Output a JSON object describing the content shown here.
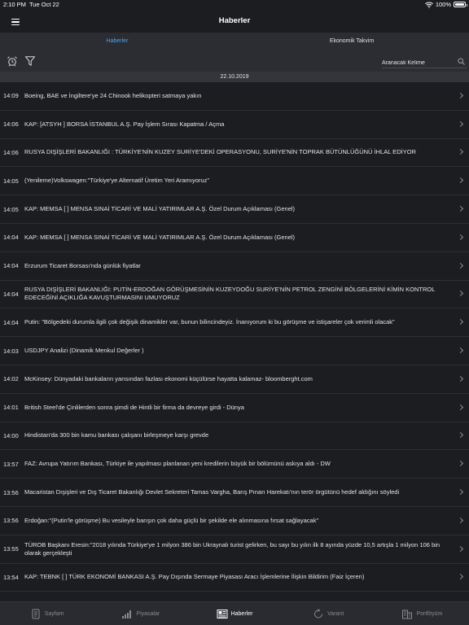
{
  "status_bar": {
    "time": "2:10 PM",
    "date": "Tue Oct 22",
    "battery": "100%"
  },
  "nav": {
    "title": "Haberler"
  },
  "tabs": [
    {
      "label": "Haberler",
      "active": true
    },
    {
      "label": "Ekonomik Takvim",
      "active": false
    }
  ],
  "toolbar": {
    "search_placeholder": "Aranacak Kelime"
  },
  "date_header": "22.10.2019",
  "news": [
    {
      "time": "14:09",
      "headline": "Boeing, BAE ve İngiltere'ye 24 Chinook helikopteri satmaya yakın"
    },
    {
      "time": "14:06",
      "headline": "KAP:   [ATSYH ] BORSA İSTANBUL A.Ş.  Pay İşlem Sırası Kapatma / Açma"
    },
    {
      "time": "14:06",
      "headline": "RUSYA DIŞİŞLERİ BAKANLIĞI : TÜRKİYE'NİN KUZEY SURİYE'DEKİ OPERASYONU, SURİYE'NİN TOPRAK BÜTÜNLÜĞÜNÜ İHLAL EDİYOR"
    },
    {
      "time": "14:05",
      "headline": "(Yenileme)Volkswagen:\"Türkiye'ye Alternatif Üretim Yeri Aramıyoruz\""
    },
    {
      "time": "14:05",
      "headline": "KAP: MEMSA  [ ] MENSA SINAİ TİCARİ VE MALİ YATIRIMLAR A.Ş.  Özel Durum Açıklaması (Genel)"
    },
    {
      "time": "14:04",
      "headline": "KAP: MEMSA  [ ] MENSA SINAİ TİCARİ VE MALİ YATIRIMLAR A.Ş.  Özel Durum Açıklaması (Genel)"
    },
    {
      "time": "14:04",
      "headline": "Erzurum Ticaret Borsası'nda günlük fiyatlar"
    },
    {
      "time": "14:04",
      "headline": "RUSYA DIŞİŞLERİ BAKANLIĞI: PUTİN-ERDOĞAN GÖRÜŞMESİNİN KUZEYDOĞU SURİYE'NİN PETROL ZENGİNİ BÖLGELERİNİ KİMİN KONTROL EDECEĞİNİ AÇIKLIĞA KAVUŞTURMASINI UMUYORUZ"
    },
    {
      "time": "14:04",
      "headline": "Putin: \"Bölgedeki durumla ilgili çok değişik dinamikler var, bunun bilincindeyiz. İnanıyorum ki bu görüşme ve istişareler çok verimli olacak\""
    },
    {
      "time": "14:03",
      "headline": "USDJPY Analizi (Dinamik Menkul Değerler )"
    },
    {
      "time": "14:02",
      "headline": "McKinsey: Dünyadaki bankaların yarısından fazlası ekonomi küçülürse hayatta kalamaz-  bloomberght.com"
    },
    {
      "time": "14:01",
      "headline": "British Steel'de Çinlilerden sonra şimdi de Hintli bir firma da devreye girdi - Dünya"
    },
    {
      "time": "14:00",
      "headline": "Hindistan'da 300 bin kamu bankası çalışanı birleşmeye karşı grevde"
    },
    {
      "time": "13:57",
      "headline": "FAZ: Avrupa Yatırım Bankası, Türkiye ile yapılması planlanan yeni kredilerin büyük bir bölümünü askıya aldı - DW"
    },
    {
      "time": "13:56",
      "headline": "Macaristan Dışişleri ve Dış Ticaret Bakanlığı Devlet Sekreteri Tamas Vargha, Barış Pınarı Harekatı'nın terör örgütünü hedef aldığını söyledi"
    },
    {
      "time": "13:56",
      "headline": "Erdoğan:\"(Putin'le görüşme) Bu vesileyle barışın çok daha güçlü bir şekilde ele alınmasına fırsat sağlayacak\""
    },
    {
      "time": "13:55",
      "headline": "TÜROB Başkanı Eresin:\"2018 yılında Türkiye'ye 1 milyon 386 bin Ukraynalı turist gelirken, bu sayı bu yılın ilk 8 ayında yüzde 10,5 artışla 1 milyon 106 bin olarak gerçekleşti"
    },
    {
      "time": "13:54",
      "headline": "KAP: TEBNK  [ ] TÜRK EKONOMİ BANKASI A.Ş.  Pay Dışında Sermaye Piyasası Aracı İşlemlerine İlişkin Bildirim (Faiz İçeren)"
    }
  ],
  "tabbar": [
    {
      "label": "Sayfam",
      "icon": "page-icon",
      "active": false
    },
    {
      "label": "Piyasalar",
      "icon": "bar-chart-icon",
      "active": false
    },
    {
      "label": "Haberler",
      "icon": "news-icon",
      "active": true
    },
    {
      "label": "Varant",
      "icon": "refresh-icon",
      "active": false
    },
    {
      "label": "Portföyüm",
      "icon": "buildings-icon",
      "active": false
    }
  ],
  "colors": {
    "background": "#1c1d21",
    "bar": "#2c2d32",
    "accent": "#4aa6ef"
  }
}
